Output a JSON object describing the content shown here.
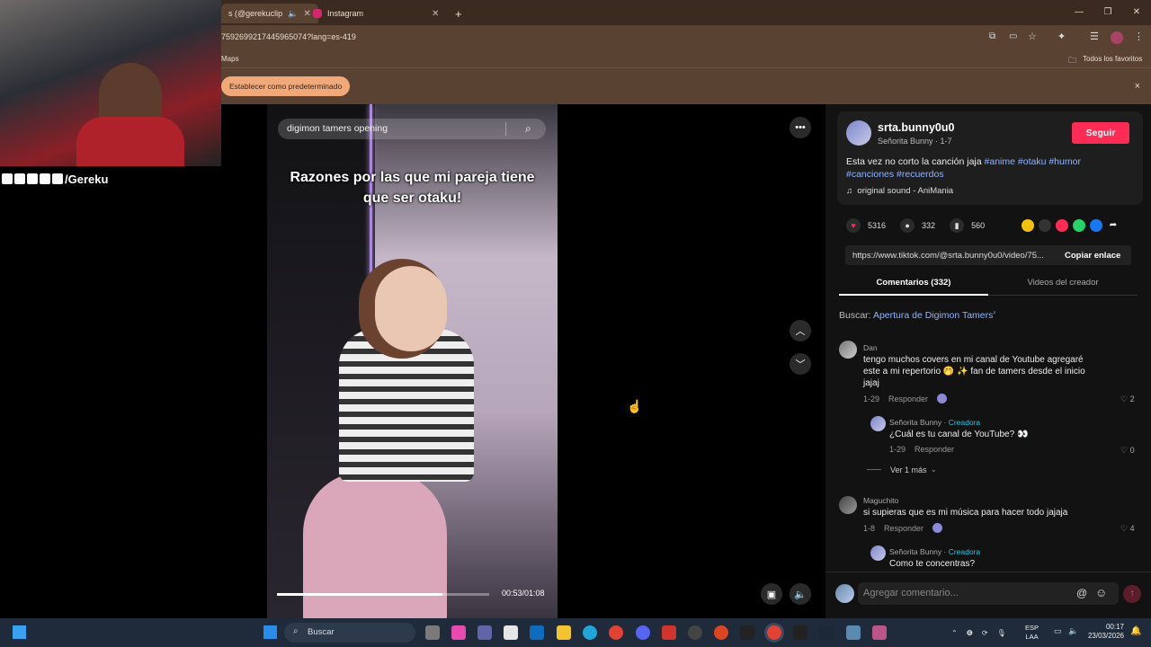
{
  "browser": {
    "tabs": [
      {
        "label": "s (@gerekuclip",
        "active": true
      },
      {
        "label": "Instagram",
        "active": false
      }
    ],
    "new_tab": "+",
    "url": "7592699217445965074?lang=es-419",
    "bookmark_left": "Maps",
    "bookmark_right": "Todos los favoritos",
    "infobar_button": "Establecer como predeterminado",
    "infobar_close": "×"
  },
  "stream": {
    "handle": "/Gereku"
  },
  "video": {
    "search_text": "digimon tamers opening",
    "caption": "Razones por las que mi pareja tiene que ser otaku!",
    "progress": 0.78,
    "timecode": "00:53/01:08"
  },
  "author": {
    "username": "srta.bunny0u0",
    "subtitle": "Señorita Bunny · 1-7",
    "follow_label": "Seguir",
    "desc_text": "Esta vez no corto la canción jaja ",
    "hashtags": [
      "#anime",
      "#otaku",
      "#humor",
      "#canciones",
      "#recuerdos"
    ],
    "sound": "original sound - AniMania"
  },
  "stats": {
    "likes": "5316",
    "comments": "332",
    "saves": "560"
  },
  "link": {
    "url": "https://www.tiktok.com/@srta.bunny0u0/video/75...",
    "copy_label": "Copiar enlace"
  },
  "tabs": {
    "comments": "Comentarios (332)",
    "videos": "Videos del creador"
  },
  "search_suggest": {
    "prefix": "Buscar: ",
    "term": "Apertura de Digimon Tamers"
  },
  "comments": [
    {
      "name": "Dan",
      "text": "tengo muchos covers en mi canal de Youtube agregaré este a mi repertorio 🤭 ✨ fan de tamers desde el inicio jajaj",
      "date": "1-29",
      "reply": "Responder",
      "likes": "2"
    },
    {
      "name": "Señorita Bunny · ",
      "badge": "Creadora",
      "text": "¿Cuál es tu canal de YouTube? 👀",
      "date": "1-29",
      "reply": "Responder",
      "likes": "0"
    },
    {
      "more": "Ver 1 más"
    },
    {
      "name": "Maguchito",
      "text": "si supieras que es mi música para hacer todo jajaja",
      "date": "1-8",
      "reply": "Responder",
      "likes": "4"
    },
    {
      "name": "Señorita Bunny · ",
      "badge": "Creadora",
      "text": "Como te concentras?"
    }
  ],
  "composer": {
    "placeholder": "Agregar comentario..."
  },
  "taskbar": {
    "search": "Buscar",
    "lang": "ESP\nLAA",
    "time": "00:17",
    "date": "23/03/2026"
  }
}
